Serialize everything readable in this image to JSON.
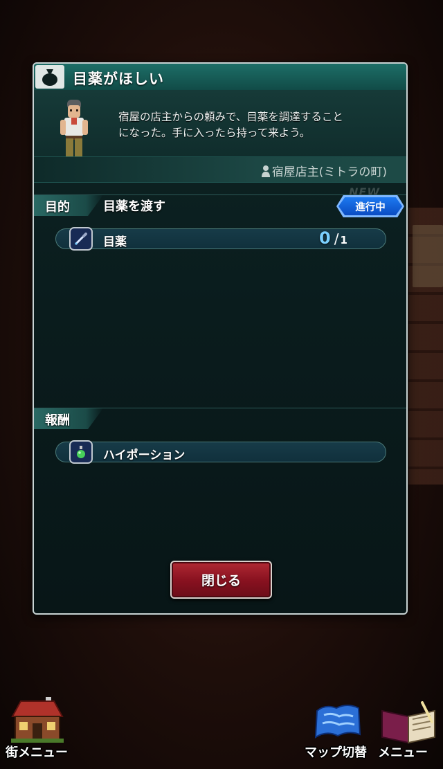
{
  "quest": {
    "title": "目薬がほしい",
    "description_line1": "宿屋の店主からの頼みで、目薬を調達すること",
    "description_line2": "になった。手に入ったら持って来よう。",
    "giver": "宿屋店主(ミトラの町)"
  },
  "objective": {
    "label": "目的",
    "text": "目薬を渡す",
    "status": "進行中",
    "faded_tag": "NEW",
    "item": {
      "name": "目薬",
      "current": "0",
      "separator": "/",
      "required": "1",
      "icon": "eye-drop-icon"
    }
  },
  "reward": {
    "label": "報酬",
    "item": {
      "name": "ハイポーション",
      "icon": "potion-icon"
    }
  },
  "buttons": {
    "close": "閉じる"
  },
  "bottom_nav": {
    "town_menu": "街メニュー",
    "map_switch": "マップ切替",
    "menu": "メニュー"
  },
  "colors": {
    "panel_bg": "#0b1f20",
    "title_bar": "#1a625c",
    "status_badge": "#1565e0",
    "count_current": "#7ad0ff",
    "close_button": "#8a1220"
  }
}
